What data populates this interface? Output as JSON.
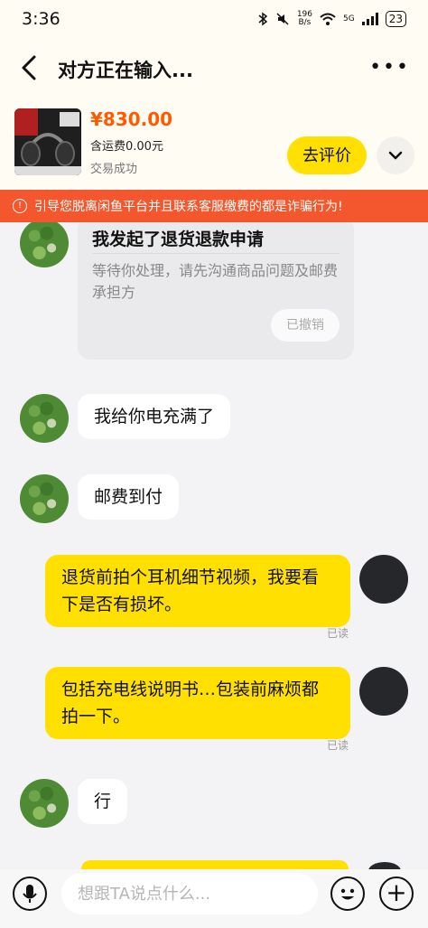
{
  "status_bar": {
    "time": "3:36",
    "speed_value": "196",
    "speed_unit": "B/s",
    "network": "5G",
    "battery": "23"
  },
  "header": {
    "title": "对方正在输入..."
  },
  "product": {
    "price": "¥830.00",
    "shipping": "含运费0.00元",
    "status": "交易成功",
    "evaluate_label": "去评价"
  },
  "warning": {
    "text": "引导您脱离闲鱼平台并且联系客服缴费的都是诈骗行为!"
  },
  "messages": {
    "refund_card": {
      "title": "我发起了退货退款申请",
      "body": "等待你处理，请先沟通商品问题及邮费承担方",
      "status": "已撤销"
    },
    "m1": "我给你电充满了",
    "m2": "邮费到付",
    "m3": "退货前拍个耳机细节视频，我要看下是否有损坏。",
    "m3_read": "已读",
    "m4": "包括充电线说明书…包装前麻烦都拍一下。",
    "m4_read": "已读",
    "m5": "行"
  },
  "input": {
    "placeholder": "想跟TA说点什么..."
  },
  "colors": {
    "accent_yellow": "#ffe000",
    "price_orange": "#ff5a00",
    "warning_red": "#f4572d"
  }
}
